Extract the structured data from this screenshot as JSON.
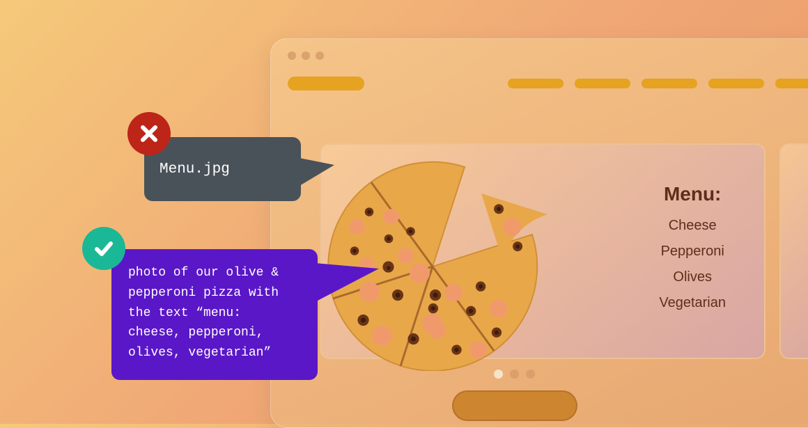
{
  "menu": {
    "title": "Menu:",
    "items": [
      "Cheese",
      "Pepperoni",
      "Olives",
      "Vegetarian"
    ]
  },
  "tooltips": {
    "bad": "Menu.jpg",
    "good": "photo of our olive & pepperoni pizza with the text “menu: cheese, pepperoni, olives, vegetarian”"
  },
  "icons": {
    "bad": "x-icon",
    "good": "check-icon"
  },
  "colors": {
    "bad_badge": "#bd2519",
    "good_badge": "#1ab896",
    "bad_tooltip": "#4a5259",
    "good_tooltip": "#5a17c7",
    "accent": "#e6a221"
  }
}
